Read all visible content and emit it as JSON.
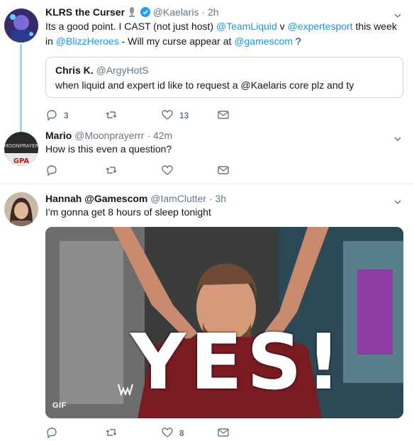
{
  "tweets": [
    {
      "name": "KLRS the Curser",
      "handle": "@Kaelaris",
      "dot": "·",
      "time": "2h",
      "body_parts": [
        "Its a good point. I CAST (not just host) ",
        "@TeamLiquid",
        " v ",
        "@expertesport",
        " this week in ",
        "@BlizzHeroes",
        " - Will my curse appear at ",
        "@gamescom",
        " ?"
      ],
      "quote": {
        "name": "Chris K.",
        "handle": "@ArgyHotS",
        "text": "when liquid and expert id like to request a @Kaelaris core plz and ty"
      },
      "reply_count": "3",
      "retweet_count": "",
      "like_count": "13"
    },
    {
      "name": "Mario",
      "handle": "@Moonprayerrr",
      "dot": "·",
      "time": "42m",
      "avatar_text_top": "MOONPRAYER",
      "avatar_text_bottom": "GPA",
      "body": "How is this even a question?",
      "reply_count": "",
      "retweet_count": "",
      "like_count": ""
    },
    {
      "name": "Hannah @Gamescom",
      "handle": "@IamClutter",
      "dot": "·",
      "time": "3h",
      "body": "I'm gonna get 8 hours of sleep tonight",
      "media": {
        "overlay_text": "YES!",
        "badge": "GIF"
      },
      "reply_count": "",
      "retweet_count": "",
      "like_count": "8"
    }
  ],
  "colors": {
    "link": "#1b95e0",
    "secondary": "#657786",
    "thread": "#a6d7ee",
    "divider": "#e6ecf0"
  }
}
